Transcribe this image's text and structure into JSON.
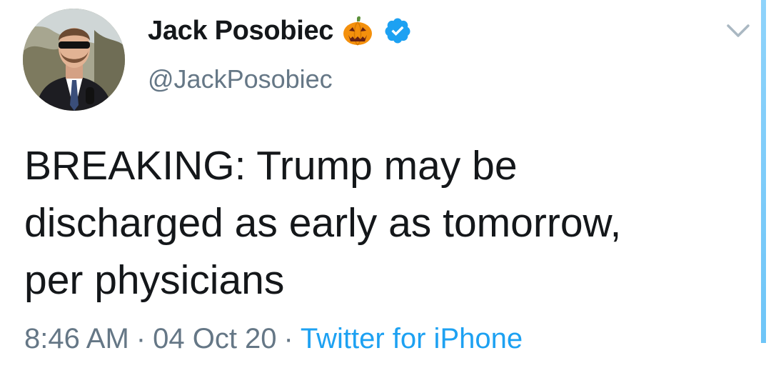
{
  "tweet": {
    "display_name": "Jack Posobiec",
    "handle": "@JackPosobiec",
    "name_emoji": "pumpkin-icon",
    "verified_icon": "verified-badge-icon",
    "menu_icon": "chevron-down-icon",
    "text": "BREAKING: Trump may be\ndischarged as early as tomorrow,\nper physicians",
    "time": "8:46 AM",
    "separator": "·",
    "date": "04 Oct 20",
    "source": "Twitter for iPhone"
  },
  "colors": {
    "text": "#14171a",
    "secondary": "#657786",
    "link": "#1da1f2",
    "verified": "#1da1f2",
    "pumpkin": "#f4900c"
  }
}
